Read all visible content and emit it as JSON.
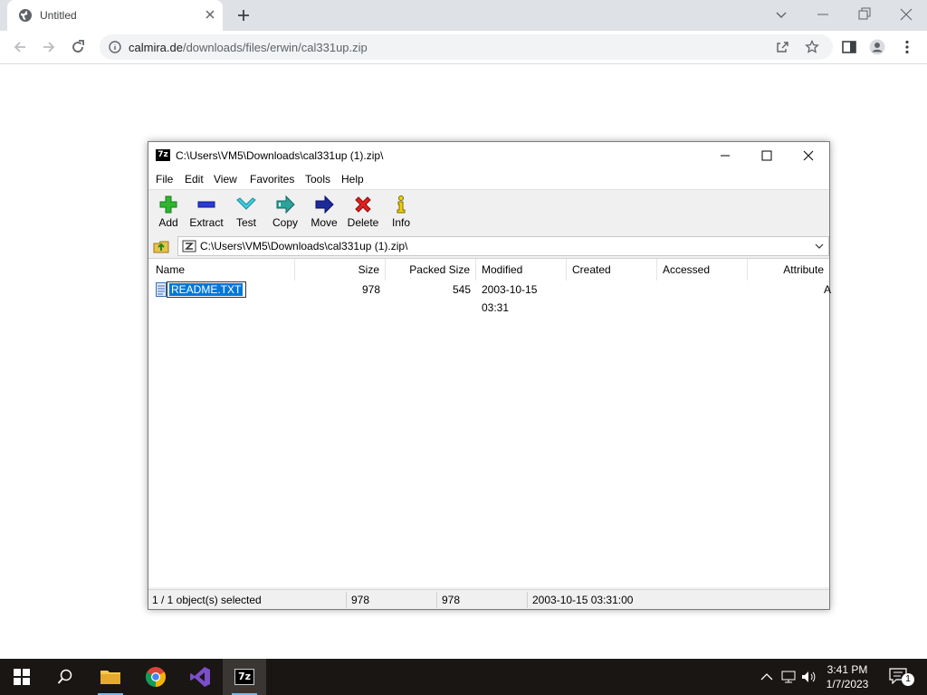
{
  "browser": {
    "tab_title": "Untitled",
    "url_host": "calmira.de",
    "url_path": "/downloads/files/erwin/cal331up.zip"
  },
  "zip": {
    "title": "C:\\Users\\VM5\\Downloads\\cal331up (1).zip\\",
    "menu": [
      "File",
      "Edit",
      "View",
      "Favorites",
      "Tools",
      "Help"
    ],
    "toolbar": {
      "add": "Add",
      "extract": "Extract",
      "test": "Test",
      "copy": "Copy",
      "move": "Move",
      "delete": "Delete",
      "info": "Info"
    },
    "address": "C:\\Users\\VM5\\Downloads\\cal331up (1).zip\\",
    "columns": {
      "name": "Name",
      "size": "Size",
      "packed": "Packed Size",
      "modified": "Modified",
      "created": "Created",
      "accessed": "Accessed",
      "attributes": "Attribute"
    },
    "file": {
      "name": "README.TXT",
      "size": "978",
      "packed": "545",
      "modified": "2003-10-15 03:31",
      "attr": "A"
    },
    "status": {
      "selected": "1 / 1 object(s) selected",
      "size": "978",
      "size2": "978",
      "date": "2003-10-15 03:31:00"
    }
  },
  "taskbar": {
    "time": "3:41 PM",
    "date": "1/7/2023",
    "notifications": "1"
  },
  "colors": {
    "selection": "#0078d7",
    "taskbar": "#1a1614",
    "chrome_tabstrip": "#dee1e6"
  }
}
